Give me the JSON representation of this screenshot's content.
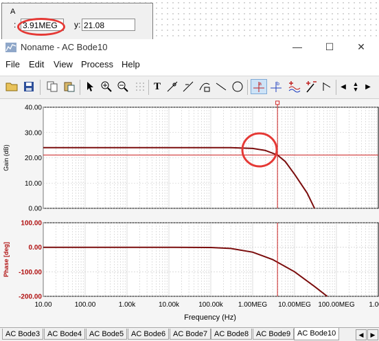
{
  "cursor_panel": {
    "header": "A",
    "x_label": ":",
    "x_value": "3.91MEG",
    "y_label": "y:",
    "y_value": "21.08"
  },
  "window": {
    "title": "Noname - AC Bode10",
    "minimize": "—",
    "maximize": "☐",
    "close": "✕"
  },
  "menu": [
    "File",
    "Edit",
    "View",
    "Process",
    "Help"
  ],
  "toolbar": {
    "icons": [
      "open-folder-icon",
      "save-icon",
      "copy-icon",
      "paste-icon",
      "pointer-icon",
      "zoom-in-icon",
      "zoom-out-icon",
      "grid-icon",
      "text-tool-icon",
      "cursor-a-tool-icon",
      "cursor-b-tool-icon",
      "add-curve-icon",
      "line-tool-icon",
      "circle-tool-icon",
      "cursor-a-marker-icon",
      "cursor-b-marker-icon",
      "add-trace-icon",
      "remove-trace-icon",
      "marker-icon",
      "scroll-left-icon",
      "scroll-right-icon",
      "scroll-updown-icon"
    ]
  },
  "chart_data": [
    {
      "type": "line",
      "title": "",
      "xlabel": "Frequency (Hz)",
      "ylabel": "Gain (dB)",
      "x_scale": "log",
      "xlim": [
        10,
        1000000000
      ],
      "ylim": [
        0,
        40
      ],
      "y_ticks": [
        "40.00",
        "30.00",
        "20.00",
        "10.00",
        "0.00"
      ],
      "grid": true,
      "series": [
        {
          "color": "#7a0c0c",
          "x": [
            10,
            100,
            1000,
            10000,
            100000,
            300000,
            1000000,
            2000000,
            3910000,
            6000000,
            10000000,
            20000000,
            30000000
          ],
          "y": [
            24.0,
            24.0,
            24.0,
            24.0,
            24.0,
            24.0,
            23.7,
            22.9,
            21.08,
            18.5,
            13.5,
            6.0,
            0.0
          ]
        }
      ],
      "cursor": {
        "x": 3910000,
        "y": 21.08
      }
    },
    {
      "type": "line",
      "title": "",
      "xlabel": "Frequency (Hz)",
      "ylabel": "Phase [deg]",
      "x_scale": "log",
      "xlim": [
        10,
        1000000000
      ],
      "ylim": [
        -200,
        100
      ],
      "y_ticks": [
        "100.00",
        "0.00",
        "-100.00",
        "-200.00"
      ],
      "x_ticks": [
        "10.00",
        "100.00",
        "1.00k",
        "10.00k",
        "100.00k",
        "1.00MEG",
        "10.00MEG",
        "100.00MEG",
        "1.00G"
      ],
      "grid": true,
      "series": [
        {
          "color": "#7a0c0c",
          "x": [
            10,
            100,
            1000,
            10000,
            100000,
            300000,
            1000000,
            3000000,
            10000000,
            30000000,
            60000000
          ],
          "y": [
            0,
            0,
            0,
            0,
            -1,
            -5,
            -20,
            -50,
            -100,
            -160,
            -200
          ]
        }
      ],
      "cursor": {
        "x": 3910000
      }
    }
  ],
  "tabs": [
    "AC Bode3",
    "AC Bode4",
    "AC Bode5",
    "AC Bode6",
    "AC Bode7",
    "AC Bode8",
    "AC Bode9",
    "AC Bode10"
  ],
  "active_tab": "AC Bode10",
  "colors": {
    "curve": "#7a0c0c",
    "cursor": "#cc2222",
    "annotation": "#e53935"
  }
}
